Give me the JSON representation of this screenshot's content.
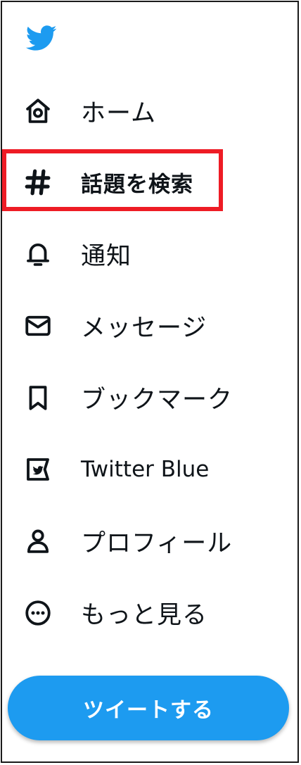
{
  "brand": {
    "logo_icon": "twitter-bird-icon",
    "accent_color": "#1d9bf0"
  },
  "nav": {
    "items": [
      {
        "id": "home",
        "label": "ホーム",
        "icon": "home-icon",
        "active": false
      },
      {
        "id": "explore",
        "label": "話題を検索",
        "icon": "hashtag-icon",
        "active": true
      },
      {
        "id": "notifications",
        "label": "通知",
        "icon": "bell-icon",
        "active": false
      },
      {
        "id": "messages",
        "label": "メッセージ",
        "icon": "envelope-icon",
        "active": false
      },
      {
        "id": "bookmarks",
        "label": "ブックマーク",
        "icon": "bookmark-icon",
        "active": false
      },
      {
        "id": "twitter-blue",
        "label": "Twitter Blue",
        "icon": "twitter-blue-icon",
        "active": false
      },
      {
        "id": "profile",
        "label": "プロフィール",
        "icon": "person-icon",
        "active": false
      },
      {
        "id": "more",
        "label": "もっと見る",
        "icon": "more-circle-icon",
        "active": false
      }
    ]
  },
  "annotation": {
    "highlight_color": "#ee1c25"
  },
  "tweet_button": {
    "label": "ツイートする"
  }
}
